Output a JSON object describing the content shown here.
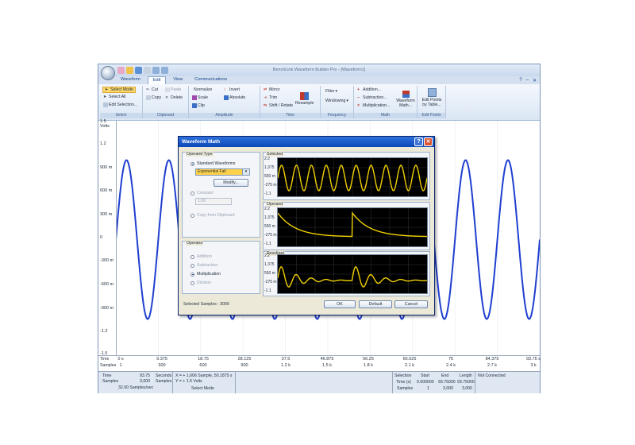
{
  "app": {
    "window_title": "BenchLink Waveform Builder Pro - [Waveform1]",
    "tabs": [
      "Waveform",
      "Edit",
      "View",
      "Communications"
    ],
    "active_tab": "Edit"
  },
  "ribbon": {
    "select": {
      "buttons": [
        "Select Mode",
        "Select All",
        "Edit Selection..."
      ],
      "label": "Select"
    },
    "clipboard": {
      "buttons": [
        "Cut",
        "Paste",
        "Copy",
        "Delete"
      ],
      "label": "Clipboard"
    },
    "amplitude": {
      "buttons": [
        "Normalize",
        "Invert",
        "Scale",
        "Absolute",
        "Clip"
      ],
      "label": "Amplitude"
    },
    "time": {
      "buttons": [
        "Mirror",
        "Trim",
        "Shift / Rotate",
        "Resample"
      ],
      "label": "Time"
    },
    "frequency": {
      "buttons": [
        "Filter",
        "Windowing"
      ],
      "label": "Frequency"
    },
    "math": {
      "buttons": [
        "Addition...",
        "Subtraction...",
        "Multiplication...",
        "Waveform Math..."
      ],
      "label": "Math"
    },
    "editpoints": {
      "buttons": [
        "Edit Points by Table..."
      ],
      "label": "Edit Points"
    }
  },
  "plot": {
    "y_ticks": [
      "1.5",
      "Volts",
      "1.2",
      "900 m",
      "600 m",
      "300 m",
      "0",
      "-300 m",
      "-600 m",
      "-900 m",
      "-1.2",
      "-1.5"
    ],
    "x_row_labels": [
      "Time",
      "Samples"
    ],
    "x_time_ticks": [
      "0 s",
      "9.375",
      "18.75",
      "28.125",
      "37.5",
      "46.875",
      "56.25",
      "65.625",
      "75",
      "84.375",
      "93.75 s"
    ],
    "x_sample_ticks": [
      "1",
      "300",
      "600",
      "900",
      "1.2 k",
      "1.5 k",
      "1.8 k",
      "2.1 k",
      "2.4 k",
      "2.7 k",
      "3 k"
    ],
    "trace_color": "#1f3fd0"
  },
  "status": {
    "time_label": "Time",
    "time_value": "93.75",
    "time_unit": "Seconds",
    "samples_label": "Samples",
    "samples_value": "3,000",
    "samples_unit": "Samples",
    "rate": "32.00 Samples/sec",
    "cursor_x": "X = + 1,606 Sample, 50.1875 s",
    "cursor_y": "Y = + 1.5 Volts",
    "mode": "Select Mode",
    "sel_header": "Selection",
    "sel_cols": [
      "Start",
      "End",
      "Length"
    ],
    "sel_time_label": "Time (s)",
    "sel_time": [
      "0.000000",
      "93.75000",
      "93.75000"
    ],
    "sel_samples_label": "Samples",
    "sel_samples": [
      "1",
      "3,000",
      "3,000"
    ],
    "connection": "Not Connected"
  },
  "dialog": {
    "title": "Waveform Math",
    "operand_type_label": "Operand Type",
    "standard_waveforms": "Standard Waveforms",
    "operand_selected": "Exponential Fall",
    "modify_label": "Modify...",
    "constant_label": "Constant",
    "constant_value": "1.00",
    "copy_clipboard": "Copy from Clipboard",
    "operator_label": "Operator",
    "operators": [
      "Addition",
      "Subtraction",
      "Multiplication",
      "Division"
    ],
    "selected_operator": "Multiplication",
    "selected_samples": "Selected Samples : 3000",
    "ok": "OK",
    "default": "Default",
    "cancel": "Cancel",
    "panels": [
      "Selected",
      "Operand",
      "Resultant"
    ],
    "mini_ticks": [
      "2.2",
      "1.375",
      "550 m",
      "-275 m",
      "-1.1"
    ],
    "trace_color": "#f0d000"
  }
}
